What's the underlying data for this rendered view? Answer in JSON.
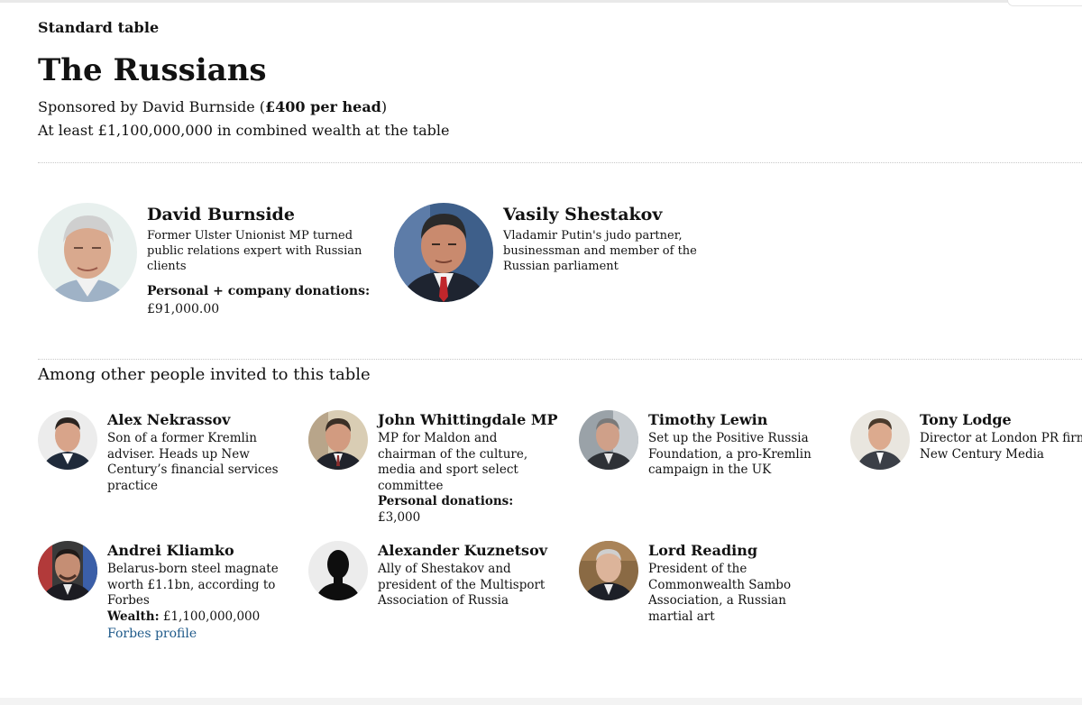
{
  "header": {
    "kicker": "Standard table",
    "title": "The Russians",
    "sponsor_prefix": "Sponsored by David Burnside (",
    "sponsor_price": "£400 per head",
    "sponsor_suffix": ")",
    "wealth_line": "At least £1,100,000,000 in combined wealth at the table"
  },
  "main_guests": [
    {
      "name": "David Burnside",
      "description": "Former Ulster Unionist MP turned public relations expert with Russian clients",
      "donation_label": "Personal + company donations:",
      "donation_value": "£91,000.00"
    },
    {
      "name": "Vasily Shestakov",
      "description": "Vladamir Putin's judo partner, businessman and member of the Russian parliament"
    }
  ],
  "others_heading": "Among other people invited to this table",
  "other_guests": [
    {
      "name": "Alex Nekrassov",
      "description": "Son of a former Kremlin adviser. Heads up New Century’s financial services practice"
    },
    {
      "name": "John Whittingdale MP",
      "description": "MP for Maldon and chairman of the culture, media and sport select committee",
      "extra_label": "Personal donations:",
      "extra_value": " £3,000"
    },
    {
      "name": "Timothy Lewin",
      "description": "Set up the Positive Russia Foundation, a pro-Kremlin campaign in the UK"
    },
    {
      "name": "Tony Lodge",
      "description": "Director at London PR firm New Century Media"
    },
    {
      "name": "Andrei Kliamko",
      "description": "Belarus-born steel magnate worth £1.1bn, according to Forbes",
      "extra_label": "Wealth:",
      "extra_value": " £1,100,000,000",
      "link": "Forbes profile"
    },
    {
      "name": "Alexander Kuznetsov",
      "description": "Ally of Shestakov and president of the Multisport Association of Russia"
    },
    {
      "name": "Lord Reading",
      "description": "President of the Commonwealth Sambo Association, a Russian martial art"
    }
  ],
  "colors": {
    "text": "#121212",
    "link": "#1f5a8a",
    "divider": "#c8c8c8"
  }
}
